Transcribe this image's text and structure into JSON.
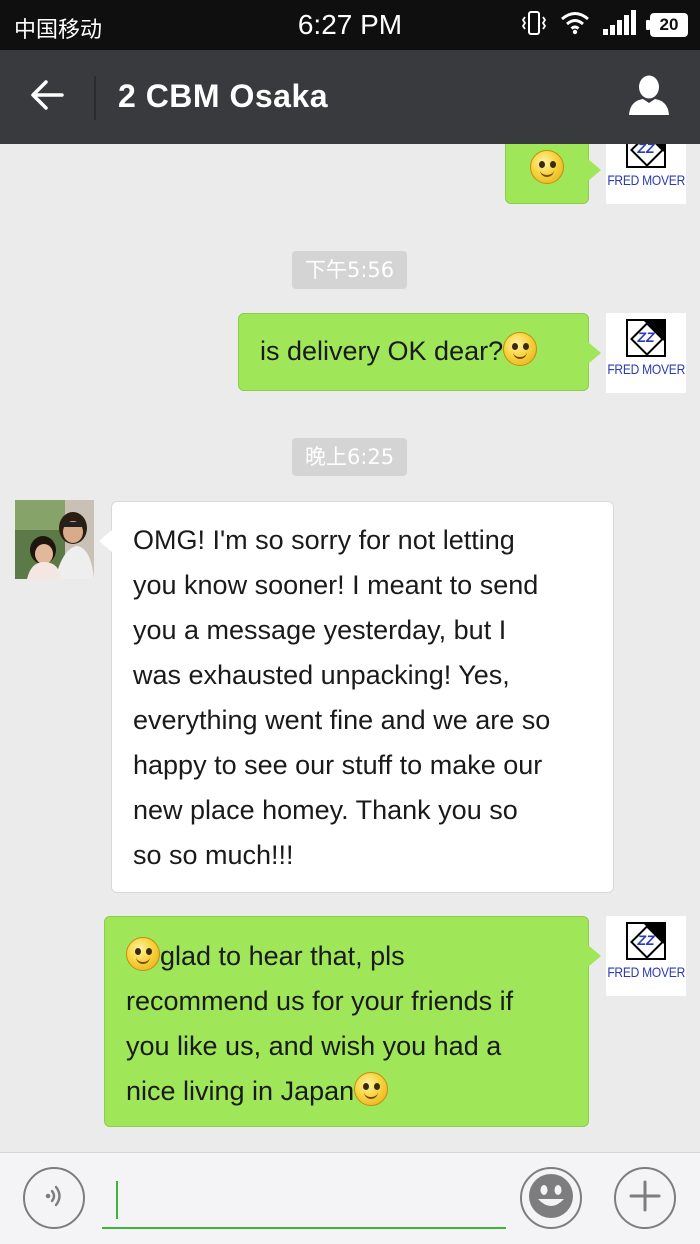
{
  "status_bar": {
    "carrier": "中国移动",
    "time": "6:27 PM",
    "battery": "20",
    "icons": [
      "vibrate-icon",
      "wifi-icon",
      "signal-icon",
      "battery-icon"
    ]
  },
  "header": {
    "back_icon": "back-arrow-icon",
    "title": "2 CBM Osaka",
    "profile_icon": "person-icon"
  },
  "avatars": {
    "self_logo_text": "FRED MOVER",
    "self_logo_mark": "ZZ"
  },
  "messages": [
    {
      "type": "outgoing",
      "text_before": "",
      "emoji_before": false,
      "text_after": "",
      "emoji_after": true
    },
    {
      "type": "timestamp",
      "text": "下午5:56"
    },
    {
      "type": "outgoing",
      "text": "is delivery OK dear?",
      "emoji_after": true
    },
    {
      "type": "timestamp",
      "text": "晚上6:25"
    },
    {
      "type": "incoming",
      "lines": [
        "OMG! I'm so sorry for not letting",
        "you know sooner! I meant to send",
        "you a message yesterday, but I",
        "was exhausted unpacking! Yes,",
        "everything went fine and we are so",
        "happy to see our stuff to make our",
        "new place homey. Thank you so",
        "so so much!!!"
      ]
    },
    {
      "type": "outgoing",
      "lines": [
        "glad to hear that, pls",
        "recommend us for your friends if",
        "you like us, and wish you had a",
        "nice living in Japan"
      ],
      "emoji_first_line_start": true,
      "emoji_last_line_end": true
    }
  ],
  "input_bar": {
    "voice_icon": "voice-icon",
    "emoji_icon": "emoji-icon",
    "add_icon": "plus-icon",
    "input_value": ""
  },
  "colors": {
    "status_bg": "#0f0f10",
    "header_bg": "#383a3d",
    "chat_bg": "#ebebeb",
    "outgoing_bubble": "#9fe658",
    "incoming_bubble": "#ffffff",
    "timestamp_bg": "#d4d4d4",
    "input_accent": "#40b33a"
  }
}
